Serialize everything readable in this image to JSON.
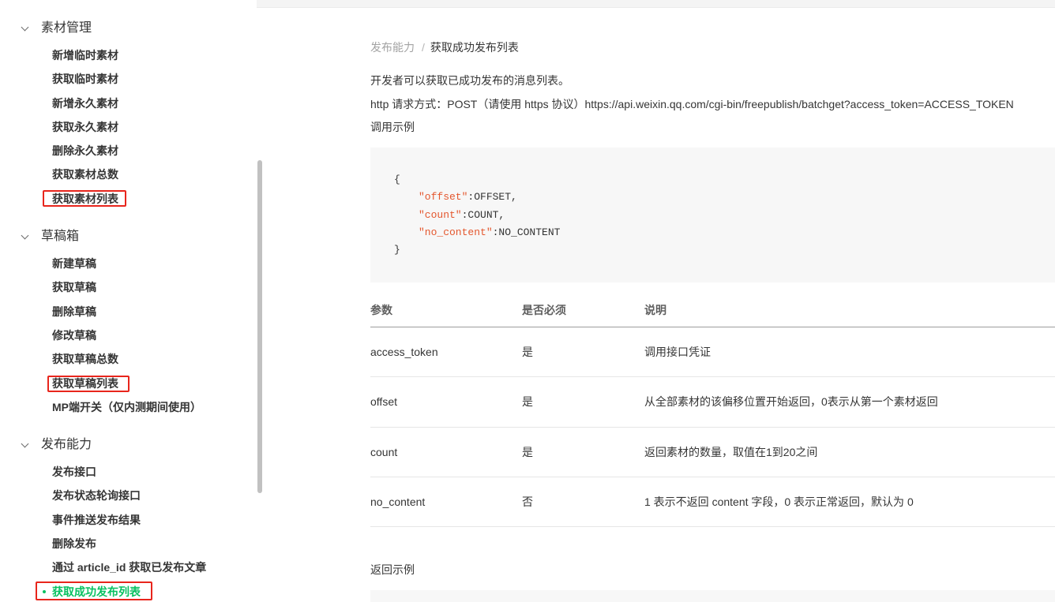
{
  "colors": {
    "accent": "#07c160",
    "annotation": "#e8251c",
    "code_key": "#e4572e"
  },
  "sidebar": {
    "sections": [
      {
        "title": "素材管理",
        "icon": "chevron-down-icon",
        "items": [
          "新增临时素材",
          "获取临时素材",
          "新增永久素材",
          "获取永久素材",
          "删除永久素材",
          "获取素材总数",
          "获取素材列表"
        ]
      },
      {
        "title": "草稿箱",
        "icon": "chevron-down-icon",
        "items": [
          "新建草稿",
          "获取草稿",
          "删除草稿",
          "修改草稿",
          "获取草稿总数",
          "获取草稿列表",
          "MP端开关（仅内测期间使用）"
        ]
      },
      {
        "title": "发布能力",
        "icon": "chevron-down-icon",
        "items": [
          "发布接口",
          "发布状态轮询接口",
          "事件推送发布结果",
          "删除发布",
          "通过 article_id 获取已发布文章",
          "获取成功发布列表"
        ]
      }
    ],
    "active_item": "获取成功发布列表"
  },
  "breadcrumb": {
    "parent": "发布能力",
    "separator": "/",
    "current": "获取成功发布列表"
  },
  "intro": "开发者可以获取已成功发布的消息列表。",
  "request_line": "http 请求方式：POST（请使用 https 协议）https://api.weixin.qq.com/cgi-bin/freepublish/batchget?access_token=ACCESS_TOKEN",
  "call_example": {
    "label": "调用示例",
    "open": "{",
    "entries": [
      {
        "key": "\"offset\"",
        "rest": ":OFFSET,"
      },
      {
        "key": "\"count\"",
        "rest": ":COUNT,"
      },
      {
        "key": "\"no_content\"",
        "rest": ":NO_CONTENT"
      }
    ],
    "close": "}"
  },
  "params_table": {
    "headers": [
      "参数",
      "是否必须",
      "说明"
    ],
    "rows": [
      [
        "access_token",
        "是",
        "调用接口凭证"
      ],
      [
        "offset",
        "是",
        "从全部素材的该偏移位置开始返回，0表示从第一个素材返回"
      ],
      [
        "count",
        "是",
        "返回素材的数量，取值在1到20之间"
      ],
      [
        "no_content",
        "否",
        "1 表示不返回 content 字段，0 表示正常返回，默认为 0"
      ]
    ]
  },
  "return_example": {
    "label": "返回示例"
  }
}
